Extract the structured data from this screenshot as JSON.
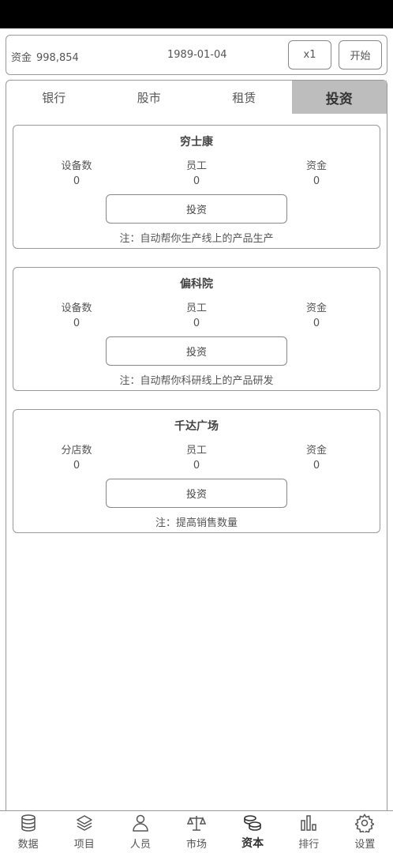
{
  "header": {
    "funds_label": "资金",
    "funds_value": "998,854",
    "date": "1989-01-04",
    "speed_label": "x1",
    "start_label": "开始"
  },
  "tabs": [
    {
      "label": "银行",
      "active": false
    },
    {
      "label": "股市",
      "active": false
    },
    {
      "label": "租赁",
      "active": false
    },
    {
      "label": "投资",
      "active": true
    }
  ],
  "cards": [
    {
      "title": "穷士康",
      "stats": [
        {
          "label": "设备数",
          "value": "0"
        },
        {
          "label": "员工",
          "value": "0"
        },
        {
          "label": "资金",
          "value": "0"
        }
      ],
      "button": "投资",
      "note": "注：自动帮你生产线上的产品生产"
    },
    {
      "title": "偏科院",
      "stats": [
        {
          "label": "设备数",
          "value": "0"
        },
        {
          "label": "员工",
          "value": "0"
        },
        {
          "label": "资金",
          "value": "0"
        }
      ],
      "button": "投资",
      "note": "注：自动帮你科研线上的产品研发"
    },
    {
      "title": "千达广场",
      "stats": [
        {
          "label": "分店数",
          "value": "0"
        },
        {
          "label": "员工",
          "value": "0"
        },
        {
          "label": "资金",
          "value": "0"
        }
      ],
      "button": "投资",
      "note": "注：提高销售数量"
    }
  ],
  "nav": [
    {
      "label": "数据",
      "icon": "database-icon",
      "active": false
    },
    {
      "label": "项目",
      "icon": "layers-icon",
      "active": false
    },
    {
      "label": "人员",
      "icon": "person-icon",
      "active": false
    },
    {
      "label": "市场",
      "icon": "scale-icon",
      "active": false
    },
    {
      "label": "资本",
      "icon": "coins-icon",
      "active": true
    },
    {
      "label": "排行",
      "icon": "bar-chart-icon",
      "active": false
    },
    {
      "label": "设置",
      "icon": "gear-icon",
      "active": false
    }
  ]
}
